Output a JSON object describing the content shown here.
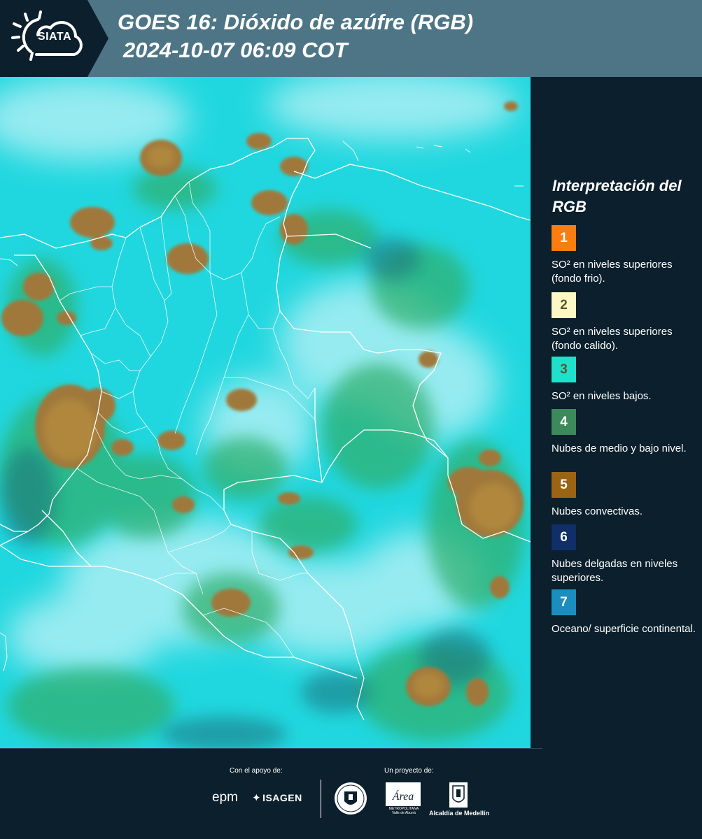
{
  "header": {
    "logo_text": "SIATA",
    "title_line1": "GOES 16: Dióxido de azúfre (RGB)",
    "title_line2": "2024-10-07 06:09 COT"
  },
  "map": {
    "background_color": "#21d7df",
    "boundary_color": "#ffffff",
    "cloud_colors": {
      "convective": "#a0783a",
      "mid_low_green": "#2fae6a",
      "thin_dark": "#1c6f7a",
      "bright_haze": "#bdf2f6"
    }
  },
  "legend": {
    "title": "Interpretación del RGB",
    "items": [
      {
        "number": "1",
        "color": "#f97d10",
        "label": "SO² en niveles superiores (fondo frio)."
      },
      {
        "number": "2",
        "color": "#fdf9c4",
        "label": "SO² en niveles superiores (fondo calido)."
      },
      {
        "number": "3",
        "color": "#20e0cb",
        "label": "SO² en niveles bajos."
      },
      {
        "number": "4",
        "color": "#3c8a5c",
        "label": "Nubes de medio y bajo nivel."
      },
      {
        "number": "5",
        "color": "#9a6414",
        "label": "Nubes convectivas."
      },
      {
        "number": "6",
        "color": "#102f68",
        "label": "Nubes delgadas en niveles superiores."
      },
      {
        "number": "7",
        "color": "#1a8fbf",
        "label": "Oceano/ superficie continental."
      }
    ]
  },
  "footer": {
    "support_caption": "Con el apoyo de:",
    "project_caption": "Un proyecto de:",
    "epm_logo": "epm",
    "isagen_logo": "ISAGEN",
    "area_logo": "Área",
    "area_caption": "METROPOLITANA Valle de Aburrá",
    "alcaldia_caption": "Alcaldía de Medellín"
  }
}
